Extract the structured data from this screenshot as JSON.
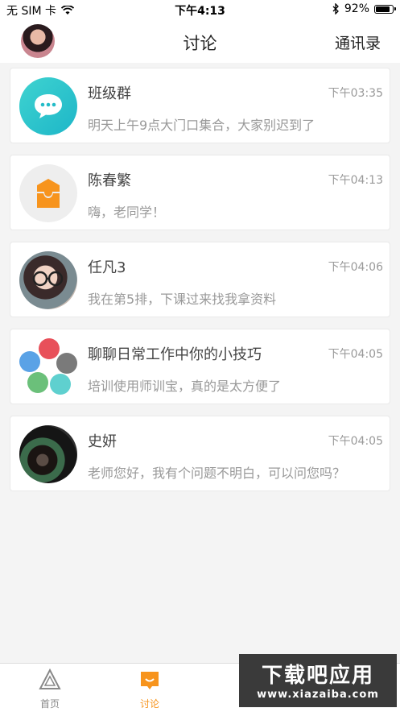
{
  "status_bar": {
    "carrier": "无 SIM 卡",
    "time": "下午4:13",
    "battery": "92%",
    "battery_level": 0.92
  },
  "nav": {
    "title": "讨论",
    "right_label": "通讯录"
  },
  "conversations": [
    {
      "name": "班级群",
      "time": "下午03:35",
      "message": "明天上午9点大门口集合，大家别迟到了",
      "avatar": "chat-bubble-icon"
    },
    {
      "name": "陈春繁",
      "time": "下午04:13",
      "message": "嗨，老同学！",
      "avatar": "default-avatar-icon"
    },
    {
      "name": "任凡3",
      "time": "下午04:06",
      "message": "我在第5排，下课过来找我拿资料",
      "avatar": "photo"
    },
    {
      "name": "聊聊日常工作中你的小技巧",
      "time": "下午04:05",
      "message": "培训使用师训宝，真的是太方便了",
      "avatar": "multi-avatar"
    },
    {
      "name": "史妍",
      "time": "下午04:05",
      "message": "老师您好，我有个问题不明白，可以问您吗？",
      "avatar": "photo"
    }
  ],
  "tabs": [
    {
      "label": "首页",
      "icon": "home-triangle-icon",
      "active": false
    },
    {
      "label": "讨论",
      "icon": "discussion-icon",
      "active": true
    }
  ],
  "watermark": {
    "main": "下载吧应用",
    "sub": "www.xiazaiba.com"
  },
  "colors": {
    "accent": "#f7941d",
    "group_avatar": "#2fc6cc"
  }
}
